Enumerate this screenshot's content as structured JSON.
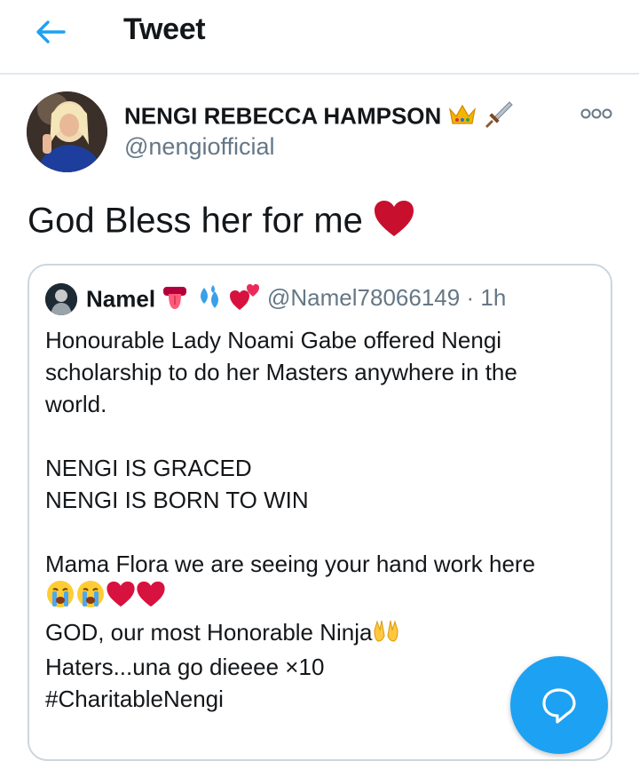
{
  "header": {
    "back_icon": "arrow-left-icon",
    "title": "Tweet",
    "accent_color": "#1da1f2"
  },
  "tweet": {
    "author_name": "NENGI REBECCA HAMPSON",
    "name_emojis": [
      "crown-icon",
      "dagger-icon"
    ],
    "handle": "@nengiofficial",
    "more_icon": "more-options-icon",
    "text": "God Bless her for me",
    "text_emoji": "red-heart-icon"
  },
  "quoted_tweet": {
    "author_name": "Namel",
    "name_emojis": [
      "tongue-icon",
      "sweat-droplets-icon",
      "two-hearts-icon"
    ],
    "handle": "@Namel78066149",
    "separator": "·",
    "time": "1h",
    "lines": {
      "l1": "Honourable Lady Noami Gabe offered Nengi",
      "l2": "scholarship to do her Masters anywhere in the",
      "l3": "world.",
      "l4": "NENGI IS GRACED",
      "l5": "NENGI IS BORN TO WIN",
      "l6": "Mama Flora we are seeing your hand work here",
      "l7_emojis": [
        "crying-face-icon",
        "crying-face-icon",
        "red-heart-icon",
        "red-heart-icon"
      ],
      "l8": "GOD, our most Honorable Ninja",
      "l8_emoji": "raising-hands-icon",
      "l9": "Haters...una go dieeee ×10",
      "l10": "#CharitableNengi"
    }
  },
  "fab": {
    "icon": "reply-icon",
    "color": "#1da1f2"
  }
}
